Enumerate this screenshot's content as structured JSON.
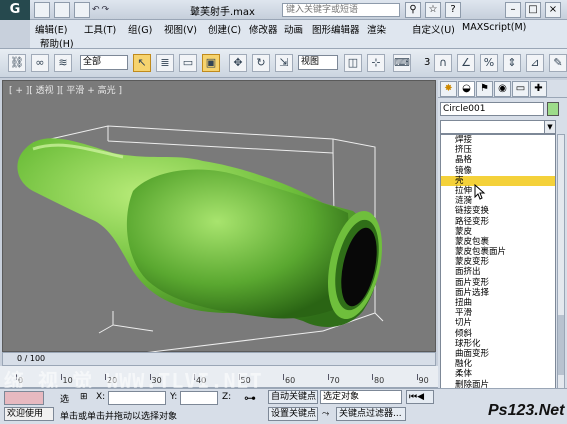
{
  "titlebar": {
    "title": "鼙芙射手.max",
    "search_placeholder": "键入关键字或短语",
    "app_icon": "3ds-max-logo"
  },
  "menu": {
    "row1": [
      "编辑(E)",
      "工具(T)",
      "组(G)",
      "视图(V)",
      "创建(C)",
      "修改器",
      "动画",
      "图形编辑器",
      "渲染",
      "自定义(U)",
      "MAXScript(M)"
    ],
    "row2": [
      "帮助(H)"
    ]
  },
  "toolbar": {
    "filter_value": "全部",
    "refcoord_value": "视图",
    "snap_label": "3"
  },
  "viewport": {
    "label": "[ + ][ 透视 ][ 平滑 + 高光 ]",
    "object_color": "#6fbf3c"
  },
  "command_panel": {
    "object_name": "Circle001",
    "modifier_list": [
      "焊接",
      "挤压",
      "晶格",
      "镜像",
      "壳",
      "拉伸",
      "涟漪",
      "链接变换",
      "路径变形",
      "蒙皮",
      "蒙皮包裹",
      "蒙皮包裹面片",
      "蒙皮变形",
      "面挤出",
      "面片变形",
      "面片选择",
      "扭曲",
      "平滑",
      "切片",
      "倾斜",
      "球形化",
      "曲面变形",
      "融化",
      "柔体",
      "删除面片"
    ],
    "highlighted_index": 4
  },
  "timeline": {
    "frame_counter": "0 / 100",
    "ticks": [
      "0",
      "10",
      "20",
      "30",
      "40",
      "50",
      "60",
      "70",
      "80",
      "90"
    ]
  },
  "watermark": "缔 视 觉 WWW.TLVI.NET",
  "status": {
    "selected_label": "选",
    "x_label": "X:",
    "y_label": "Y:",
    "z_label": "Z:",
    "autokey": "自动关键点",
    "selected_object": "选定对象",
    "set_key": "设置关键点",
    "key_filter": "关键点过滤器...",
    "welcome": "欢迎使用",
    "prompt": "单击或单击并拖动以选择对象"
  },
  "ps_logo": "Ps123.Net"
}
